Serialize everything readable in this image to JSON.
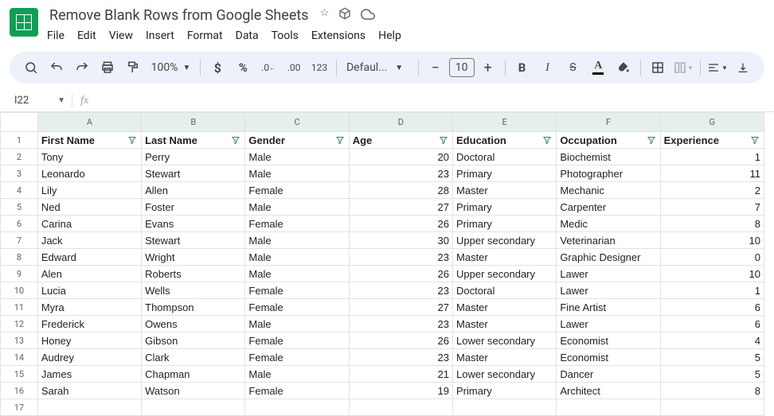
{
  "doc": {
    "title": "Remove Blank Rows from Google Sheets"
  },
  "menubar": [
    "File",
    "Edit",
    "View",
    "Insert",
    "Format",
    "Data",
    "Tools",
    "Extensions",
    "Help"
  ],
  "toolbar": {
    "zoom": "100%",
    "font": "Defaul...",
    "font_size": "10"
  },
  "name_box": "I22",
  "columns": [
    "A",
    "B",
    "C",
    "D",
    "E",
    "F",
    "G"
  ],
  "headers": [
    "First Name",
    "Last Name",
    "Gender",
    "Age",
    "Education",
    "Occupation",
    "Experience"
  ],
  "rows": [
    {
      "n": 1
    },
    {
      "n": 2,
      "a": "Tony",
      "b": "Perry",
      "c": "Male",
      "d": 20,
      "e": "Doctoral",
      "f": "Biochemist",
      "g": 1
    },
    {
      "n": 3,
      "a": "Leonardo",
      "b": "Stewart",
      "c": "Male",
      "d": 23,
      "e": "Primary",
      "f": "Photographer",
      "g": 11
    },
    {
      "n": 4,
      "a": "Lily",
      "b": "Allen",
      "c": "Female",
      "d": 28,
      "e": "Master",
      "f": "Mechanic",
      "g": 2
    },
    {
      "n": 5,
      "a": "Ned",
      "b": "Foster",
      "c": "Male",
      "d": 27,
      "e": "Primary",
      "f": "Carpenter",
      "g": 7
    },
    {
      "n": 6,
      "a": "Carina",
      "b": "Evans",
      "c": "Female",
      "d": 26,
      "e": "Primary",
      "f": "Medic",
      "g": 8
    },
    {
      "n": 7,
      "a": "Jack",
      "b": "Stewart",
      "c": "Male",
      "d": 30,
      "e": "Upper secondary",
      "f": "Veterinarian",
      "g": 10
    },
    {
      "n": 8,
      "a": "Edward",
      "b": "Wright",
      "c": "Male",
      "d": 23,
      "e": "Master",
      "f": "Graphic Designer",
      "g": 0
    },
    {
      "n": 9,
      "a": "Alen",
      "b": "Roberts",
      "c": "Male",
      "d": 26,
      "e": "Upper secondary",
      "f": "Lawer",
      "g": 10
    },
    {
      "n": 10,
      "a": "Lucia",
      "b": "Wells",
      "c": "Female",
      "d": 23,
      "e": "Doctoral",
      "f": "Lawer",
      "g": 1
    },
    {
      "n": 11,
      "a": "Myra",
      "b": "Thompson",
      "c": "Female",
      "d": 27,
      "e": "Master",
      "f": "Fine Artist",
      "g": 6
    },
    {
      "n": 12,
      "a": "Frederick",
      "b": "Owens",
      "c": "Male",
      "d": 23,
      "e": "Master",
      "f": "Lawer",
      "g": 6
    },
    {
      "n": 13,
      "a": "Honey",
      "b": "Gibson",
      "c": "Female",
      "d": 26,
      "e": "Lower secondary",
      "f": "Economist",
      "g": 4
    },
    {
      "n": 14,
      "a": "Audrey",
      "b": "Clark",
      "c": "Female",
      "d": 23,
      "e": "Master",
      "f": "Economist",
      "g": 5
    },
    {
      "n": 15,
      "a": "James",
      "b": "Chapman",
      "c": "Male",
      "d": 21,
      "e": "Lower secondary",
      "f": "Dancer",
      "g": 5
    },
    {
      "n": 16,
      "a": "Sarah",
      "b": "Watson",
      "c": "Female",
      "d": 19,
      "e": "Primary",
      "f": "Architect",
      "g": 8
    },
    {
      "n": 17
    }
  ]
}
